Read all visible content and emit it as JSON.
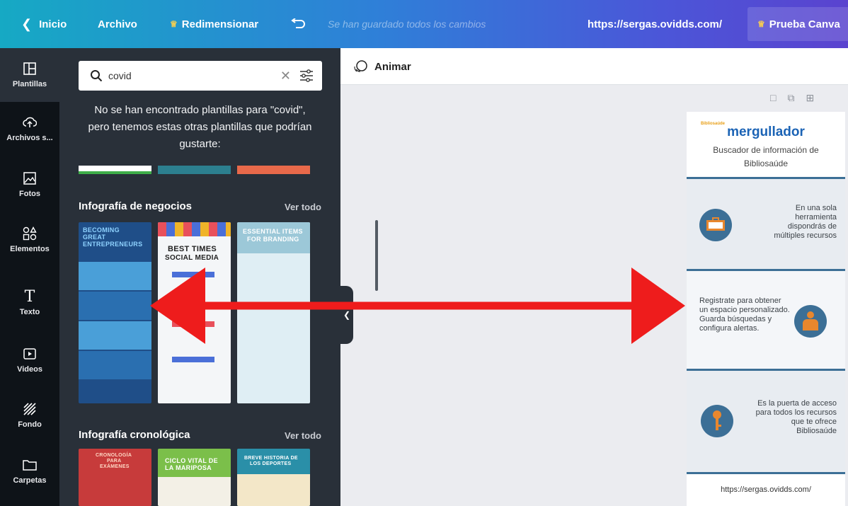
{
  "topbar": {
    "home": "Inicio",
    "file": "Archivo",
    "resize": "Redimensionar",
    "saved_status": "Se han guardado todos los cambios",
    "url": "https://sergas.ovidds.com/",
    "trial": "Prueba Canva"
  },
  "rail": {
    "items": [
      {
        "label": "Plantillas",
        "icon": "templates-icon"
      },
      {
        "label": "Archivos s...",
        "icon": "upload-cloud-icon"
      },
      {
        "label": "Fotos",
        "icon": "photo-icon"
      },
      {
        "label": "Elementos",
        "icon": "shapes-icon"
      },
      {
        "label": "Texto",
        "icon": "text-icon"
      },
      {
        "label": "Videos",
        "icon": "video-icon"
      },
      {
        "label": "Fondo",
        "icon": "background-icon"
      },
      {
        "label": "Carpetas",
        "icon": "folder-icon"
      }
    ]
  },
  "panel": {
    "search_value": "covid",
    "no_results": "No se han encontrado plantillas para \"covid\", pero tenemos estas otras plantillas que podrían gustarte:",
    "sections": [
      {
        "title": "Infografía de negocios",
        "see_all": "Ver todo"
      },
      {
        "title": "Infografía cronológica",
        "see_all": "Ver todo"
      }
    ],
    "business_templates": [
      {
        "lines": [
          "BECOMING",
          "GREAT",
          "ENTREPRENEURS"
        ]
      },
      {
        "lines": [
          "BEST TIMES",
          "SOCIAL MEDIA"
        ]
      },
      {
        "lines": [
          "ESSENTIAL ITEMS",
          "FOR BRANDING"
        ]
      }
    ],
    "timeline_templates": [
      {
        "lines": [
          "CRONOLOGÍA",
          "PARA",
          "EXÁMENES"
        ]
      },
      {
        "lines": [
          "CICLO VITAL DE",
          "LA MARIPOSA"
        ]
      },
      {
        "lines": [
          "BREVE HISTORIA DE",
          "LOS DEPORTES"
        ]
      }
    ]
  },
  "canvas": {
    "animate": "Animar",
    "design": {
      "brand_tag": "Bibliosaúde",
      "brand": "mergullador",
      "subtitle": "Buscador de información de Bibliosaúde",
      "block1": "En una sola herramienta dispondrás de múltiples recursos",
      "block2": "Registrate para obtener un espacio personalizado. Guarda búsquedas y configura alertas.",
      "block3": "Es la puerta de acceso para todos los recursos que te ofrece Bibliosaúde",
      "footer": "https://sergas.ovidds.com/"
    }
  },
  "colors": {
    "arrow": "#ee1c1c",
    "design_accent": "#3c6f96",
    "icon_orange": "#e8872e"
  }
}
